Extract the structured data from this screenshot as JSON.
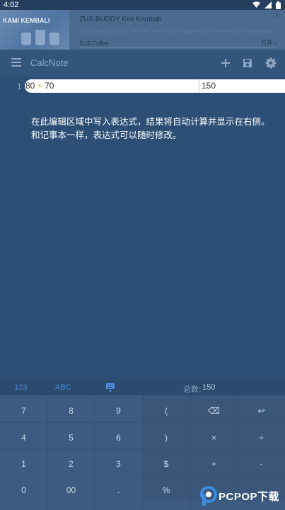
{
  "status_bar": {
    "time": "4:02",
    "icons": [
      "wifi-icon",
      "signal-icon",
      "battery-icon"
    ]
  },
  "ad": {
    "image_text": "KAMI KEMBALI",
    "title": "ZUS BUDDY Kini Kembali",
    "description": "ZUS Buddy is back! Be your new Latest! Nap watch? Download the app now",
    "brand": "ZUS Coffee",
    "open_label": "打开 ›",
    "info_label": "ⓘ"
  },
  "toolbar": {
    "title": "CalcNote",
    "icons": [
      "add-icon",
      "save-icon",
      "settings-icon"
    ]
  },
  "editor": {
    "line_number": "1",
    "expression_left": "80",
    "expression_operator": "+",
    "expression_right": "70",
    "result": "150",
    "hint": "在此编辑区域中写入表达式，结果将自动计算并显示在右侧。和记事本一样，表达式可以随时修改。"
  },
  "keyboard_bar": {
    "tab_numeric": "123",
    "tab_alpha": "ABC",
    "total_label": "总数:",
    "total_value": "150"
  },
  "keypad": {
    "rows": [
      [
        {
          "main": "7",
          "sub": ""
        },
        {
          "main": "8",
          "sub": ""
        },
        {
          "main": "9",
          "sub": ""
        },
        {
          "main": "(",
          "sub": ""
        },
        {
          "main": "⌫",
          "sub": ""
        },
        {
          "main": "↩",
          "sub": ""
        }
      ],
      [
        {
          "main": "4",
          "sub": ""
        },
        {
          "main": "5",
          "sub": ""
        },
        {
          "main": "6",
          "sub": ""
        },
        {
          "main": ")",
          "sub": ""
        },
        {
          "main": "×",
          "sub": ""
        },
        {
          "main": "÷",
          "sub": ""
        }
      ],
      [
        {
          "main": "1",
          "sub": ""
        },
        {
          "main": "2",
          "sub": ""
        },
        {
          "main": "3",
          "sub": ""
        },
        {
          "main": "$",
          "sub": ""
        },
        {
          "main": "+",
          "sub": ""
        },
        {
          "main": "-",
          "sub": ""
        }
      ],
      [
        {
          "main": "0",
          "sub": ""
        },
        {
          "main": "00",
          "sub": ""
        },
        {
          "main": ".",
          "sub": ""
        },
        {
          "main": "%",
          "sub": ""
        },
        {
          "main": "",
          "sub": ""
        },
        {
          "main": "→",
          "sub": ""
        }
      ]
    ]
  },
  "watermark": {
    "text": "PCPOP下载"
  },
  "colors": {
    "accent": "#4f8ae0",
    "operator": "#e6a01e",
    "background": "#2d4f75"
  }
}
